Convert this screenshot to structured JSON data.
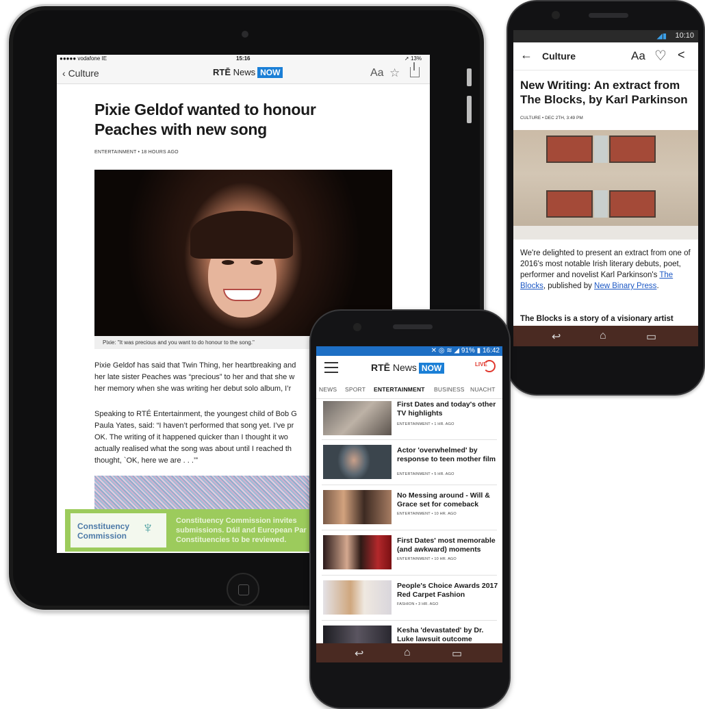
{
  "tablet": {
    "status": {
      "carrier": "●●●●● vodafone IE ",
      "time": "15:16",
      "battery": "13%"
    },
    "nav": {
      "back": "Culture",
      "logo_brand": "RTĒ",
      "logo_news": "News",
      "logo_now": "NOW",
      "font_button": "Aa"
    },
    "article": {
      "title": "Pixie Geldof wanted to honour Peaches with new song",
      "meta": "ENTERTAINMENT • 18 HOURS AGO",
      "caption": "Pixie: \"It was precious and you want to do honour to the song.\"",
      "para1": [
        "Pixie Geldof has said that Twin Thing, her heartbreaking and",
        "her late sister Peaches was “precious” to her and that she w",
        "her memory when she was writing her debut solo album, I’r"
      ],
      "para2": [
        "Speaking to RTÉ Entertainment, the youngest child of Bob G",
        "Paula Yates, said: “I haven’t performed that song yet. I’ve pr",
        "OK. The writing of it happened quicker than I thought it wo",
        "actually realised what the song was about until I reached th",
        "thought, `OK, here we are . . .’”"
      ]
    },
    "ad": {
      "name_line1": "Constituency",
      "name_line2": "Commission",
      "text_line1": "Constituency Commission invites",
      "text_line2": "submissions. Dáil and European Par",
      "text_line3": "Constituencies to be reviewed."
    }
  },
  "right_phone": {
    "status": {
      "time": "10:10"
    },
    "toolbar": {
      "back": "←",
      "section": "Culture",
      "font_button": "Aa"
    },
    "article": {
      "title": "New Writing: An extract from The Blocks, by Karl Parkinson",
      "meta": "CULTURE • DEC 2TH, 3:49 PM",
      "body_prefix": "We're delighted to present an extract from one of 2016's most notable Irish literary debuts, poet, performer and novelist Karl Parkinson's ",
      "link1": "The Blocks",
      "body_mid": ", published by ",
      "link2": "New Binary Press",
      "body_suffix": ".",
      "body2": "The Blocks is a story of a visionary artist"
    }
  },
  "front_phone": {
    "status": {
      "battery": "91%",
      "time": "16:42"
    },
    "appbar": {
      "logo_brand": "RTĒ",
      "logo_news": "News",
      "logo_now": "NOW",
      "live": "LIVE"
    },
    "tabs": [
      "NEWS",
      "SPORT",
      "ENTERTAINMENT",
      "BUSINESS",
      "NUACHT"
    ],
    "active_tab": "ENTERTAINMENT",
    "items": [
      {
        "headline": "First Dates and today's other TV highlights",
        "meta": "ENTERTAINMENT • 1 HR. AGO"
      },
      {
        "headline": "Actor 'overwhelmed' by response to teen mother film",
        "meta": "ENTERTAINMENT • 5 HR. AGO"
      },
      {
        "headline": "No Messing around - Will & Grace set for comeback",
        "meta": "ENTERTAINMENT • 10 HR. AGO"
      },
      {
        "headline": "First Dates' most memorable (and awkward) moments",
        "meta": "ENTERTAINMENT • 10 HR. AGO"
      },
      {
        "headline": "People's Choice Awards 2017 Red Carpet Fashion",
        "meta": "FASHION • 3 HR. AGO"
      },
      {
        "headline": "Kesha 'devastated' by Dr. Luke lawsuit outcome",
        "meta": ""
      }
    ]
  },
  "colors": {
    "brand_blue": "#1b7fd6",
    "status_blue": "#1e6fc4",
    "link_blue": "#1b57c4",
    "ad_green": "#9ccb5c"
  }
}
